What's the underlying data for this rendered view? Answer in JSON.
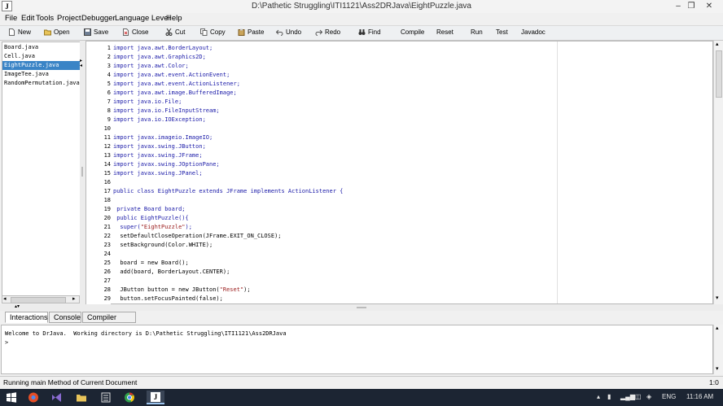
{
  "window": {
    "title": "D:\\Pathetic Struggling\\ITI1121\\Ass2DRJava\\EightPuzzle.java",
    "app_icon_glyph": "J",
    "minimize": "‒",
    "restore": "❐",
    "close": "✕"
  },
  "menu": [
    "File",
    "Edit",
    "Tools",
    "Project",
    "Debugger",
    "Language Level",
    "Help"
  ],
  "toolbar": {
    "new": "New",
    "open": "Open",
    "save": "Save",
    "close": "Close",
    "cut": "Cut",
    "copy": "Copy",
    "paste": "Paste",
    "undo": "Undo",
    "redo": "Redo",
    "find": "Find",
    "compile": "Compile",
    "reset": "Reset",
    "run": "Run",
    "test": "Test",
    "javadoc": "Javadoc"
  },
  "files": [
    "Board.java",
    "Cell.java",
    "EightPuzzle.java",
    "ImageTee.java",
    "RandomPermutation.java"
  ],
  "selected_file": "EightPuzzle.java",
  "line_numbers": [
    "1",
    "2",
    "3",
    "4",
    "5",
    "6",
    "7",
    "8",
    "9",
    "10",
    "11",
    "12",
    "13",
    "14",
    "15",
    "16",
    "17",
    "18",
    "19",
    "20",
    "21",
    "22",
    "23",
    "24",
    "25",
    "26",
    "27",
    "28",
    "29"
  ],
  "code": {
    "l1": "import java.awt.BorderLayout;",
    "l2": "import java.awt.Graphics2D;",
    "l3": "import java.awt.Color;",
    "l4": "import java.awt.event.ActionEvent;",
    "l5": "import java.awt.event.ActionListener;",
    "l6": "import java.awt.image.BufferedImage;",
    "l7": "import java.io.File;",
    "l8": "import java.io.FileInputStream;",
    "l9": "import java.io.IOException;",
    "l11": "import javax.imageio.ImageIO;",
    "l12": "import javax.swing.JButton;",
    "l13": "import javax.swing.JFrame;",
    "l14": "import javax.swing.JOptionPane;",
    "l15": "import javax.swing.JPanel;",
    "l17": "public class EightPuzzle extends JFrame implements ActionListener {",
    "l19": " private Board board;",
    "l20": " public EightPuzzle(){",
    "l21a": "  super(",
    "l21b": "\"EightPuzzle\"",
    "l21c": ");",
    "l22": "  setDefaultCloseOperation(JFrame.EXIT_ON_CLOSE);",
    "l23": "  setBackground(Color.WHITE);",
    "l25": "  board = new Board();",
    "l26": "  add(board, BorderLayout.CENTER);",
    "l28a": "  JButton button = new JButton(",
    "l28b": "\"Reset\"",
    "l28c": ");",
    "l29": "  button.setFocusPainted(false);"
  },
  "tabs": [
    "Interactions",
    "Console",
    "Compiler Output"
  ],
  "console_lines": [
    "Welcome to DrJava.  Working directory is D:\\Pathetic Struggling\\ITI1121\\Ass2DRJava",
    ">"
  ],
  "status": {
    "message": "Running main Method of Current Document",
    "position": "1:0"
  },
  "taskbar": {
    "language": "ENG",
    "clock": "11:16 AM"
  },
  "colors": {
    "selection": "#3a84c6",
    "keyword": "#1a1aa8",
    "string": "#9a1a1a",
    "taskbar": "#1c2533"
  }
}
